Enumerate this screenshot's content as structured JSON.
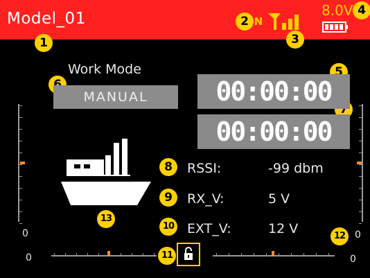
{
  "header": {
    "model_name": "Model_01",
    "signal_label": "IN",
    "signal_icon": "signal-bars-icon",
    "voltage": "8.0V",
    "battery_icon": "battery-full-icon"
  },
  "badges": [
    "1",
    "2",
    "3",
    "4",
    "5",
    "6",
    "7",
    "8",
    "9",
    "10",
    "11",
    "12",
    "13"
  ],
  "work_mode": {
    "label": "Work Mode",
    "value": "MANUAL"
  },
  "timers": [
    "00:00:00",
    "00:00:00"
  ],
  "telemetry": [
    {
      "label": "RSSI:",
      "value": "-99 dbm"
    },
    {
      "label": "RX_V:",
      "value": "5 V"
    },
    {
      "label": "EXT_V:",
      "value": "12 V"
    }
  ],
  "trim_values": {
    "left_vertical": "0",
    "left_horizontal": "0",
    "right_vertical": "0",
    "right_horizontal": "0"
  },
  "model_icon": "boat-icon",
  "lock_icon": "unlock-icon",
  "colors": {
    "header_bg": "#ff2020",
    "accent": "#ffd000",
    "trim_marker": "#ff8a2a",
    "background": "#000000",
    "panel_gray": "#8a8a8a"
  }
}
